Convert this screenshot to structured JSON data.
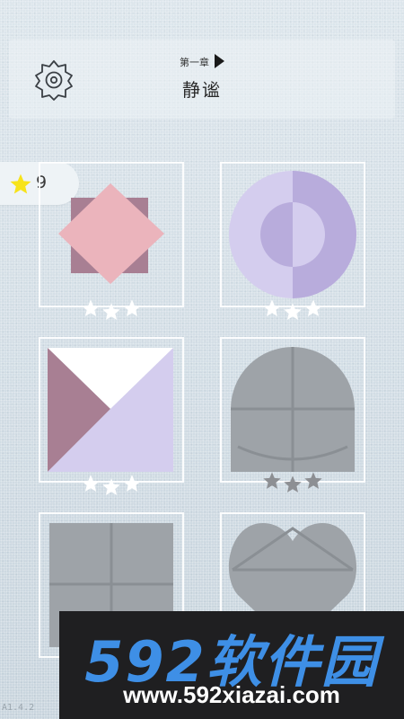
{
  "header": {
    "chapter_label": "第一章",
    "chapter_title": "静谧"
  },
  "stars_collected": "9",
  "levels": [
    {
      "name": "level-1",
      "stars_earned": 3,
      "status": "completed"
    },
    {
      "name": "level-2",
      "stars_earned": 3,
      "status": "completed"
    },
    {
      "name": "level-3",
      "stars_earned": 3,
      "status": "completed"
    },
    {
      "name": "level-4",
      "stars_earned": 3,
      "status": "available"
    },
    {
      "name": "level-5",
      "status": "locked"
    },
    {
      "name": "level-6",
      "status": "locked"
    }
  ],
  "version": "A1.4.2",
  "watermark": {
    "brand": "592软件园",
    "url": "www.592xiazai.com"
  },
  "colors": {
    "pink": "#ebb4bc",
    "mauve": "#a87f93",
    "lavender": "#d4cdee",
    "violet": "#b8acdc",
    "locked_gray": "#9ea3a8",
    "star_gold": "#f7e31a",
    "banner_blue": "#3e8fe6"
  },
  "icons": [
    "gear-icon",
    "play-triangle-icon",
    "star-icon"
  ]
}
